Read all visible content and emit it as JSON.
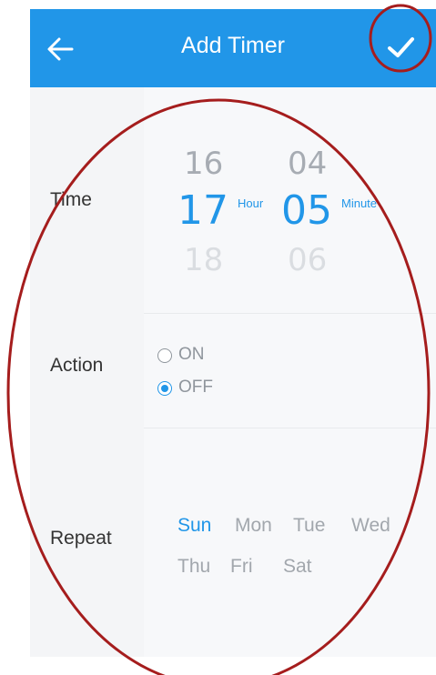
{
  "header": {
    "title": "Add Timer",
    "back_icon": "back-arrow-icon",
    "confirm_icon": "checkmark-icon",
    "background": "#2196e8"
  },
  "rows": {
    "time_label": "Time",
    "action_label": "Action",
    "repeat_label": "Repeat"
  },
  "time_picker": {
    "hour": {
      "above": "16",
      "selected": "17",
      "below": "18",
      "unit": "Hour"
    },
    "minute": {
      "above": "04",
      "selected": "05",
      "below": "06",
      "unit": "Minute"
    }
  },
  "action": {
    "options": [
      {
        "label": "ON",
        "selected": false
      },
      {
        "label": "OFF",
        "selected": true
      }
    ]
  },
  "repeat": {
    "days": [
      {
        "label": "Sun",
        "selected": true
      },
      {
        "label": "Mon",
        "selected": false
      },
      {
        "label": "Tue",
        "selected": false
      },
      {
        "label": "Wed",
        "selected": false
      },
      {
        "label": "Thu",
        "selected": false
      },
      {
        "label": "Fri",
        "selected": false
      },
      {
        "label": "Sat",
        "selected": false
      }
    ]
  },
  "colors": {
    "accent": "#2196e8",
    "annotation": "#a51d1d",
    "muted_text": "#a2a7ad"
  }
}
